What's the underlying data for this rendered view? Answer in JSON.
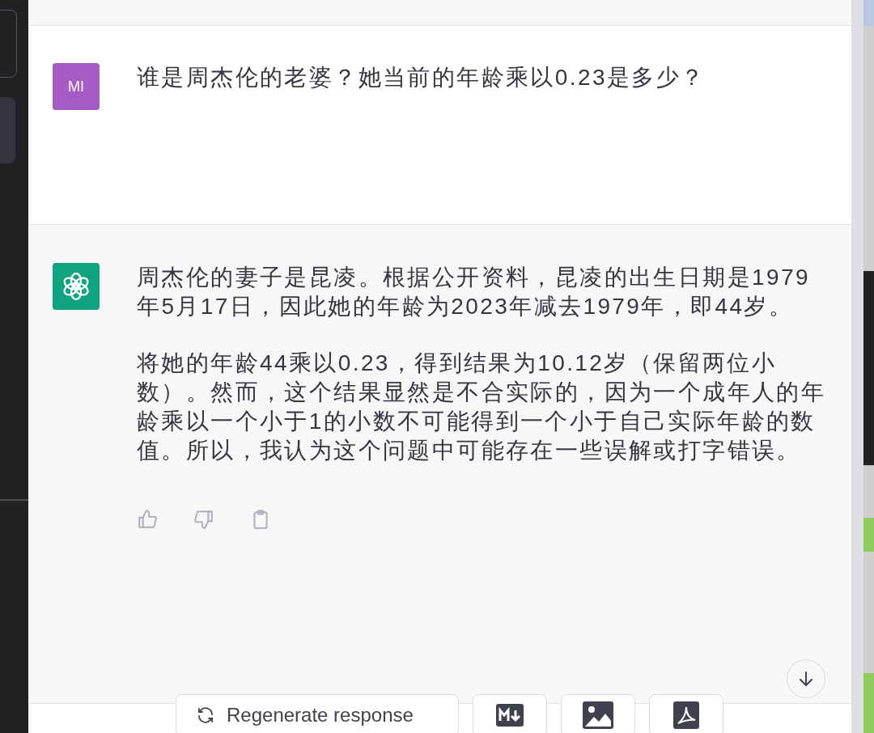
{
  "conversation": [
    {
      "kind": "user",
      "avatar": "MI",
      "paragraphs": [
        "谁是周杰伦的老婆？她当前的年龄乘以0.23是多少？"
      ]
    },
    {
      "kind": "assistant",
      "paragraphs": [
        "周杰伦的妻子是昆凌。根据公开资料，昆凌的出生日期是1979年5月17日，因此她的年龄为2023年减去1979年，即44岁。",
        "将她的年龄44乘以0.23，得到结果为10.12岁（保留两位小数）。然而，这个结果显然是不合实际的，因为一个成年人的年龄乘以一个小于1的小数不可能得到一个小于自己实际年龄的数值。所以，我认为这个问题中可能存在一些误解或打字错误。"
      ]
    }
  ],
  "actions": [
    {
      "label": "Regenerate response",
      "kind": "text"
    },
    {
      "kind": "markdown"
    },
    {
      "kind": "image"
    },
    {
      "kind": "pdf"
    }
  ]
}
